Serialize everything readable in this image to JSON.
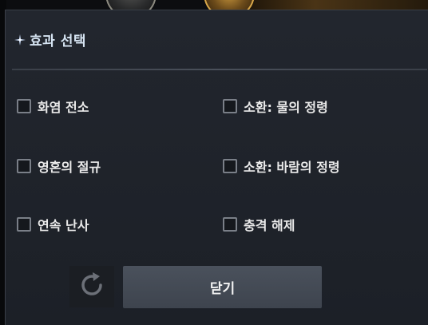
{
  "dialog": {
    "title": "효과 선택",
    "title_icon": "sparkle-icon"
  },
  "options": {
    "left": [
      {
        "label": "화염 전소",
        "checked": false
      },
      {
        "label": "영혼의 절규",
        "checked": false
      },
      {
        "label": "연속 난사",
        "checked": false
      }
    ],
    "right": [
      {
        "label": "소환: 물의 정령",
        "checked": false
      },
      {
        "label": "소환: 바람의 정령",
        "checked": false
      },
      {
        "label": "충격 해제",
        "checked": false
      }
    ]
  },
  "buttons": {
    "refresh_icon": "refresh-icon",
    "close_label": "닫기"
  },
  "colors": {
    "panel_bg": "#1f232a",
    "title_text": "#d6e4f2",
    "option_text": "#eaeaea",
    "close_button_bg": "#454c57"
  }
}
